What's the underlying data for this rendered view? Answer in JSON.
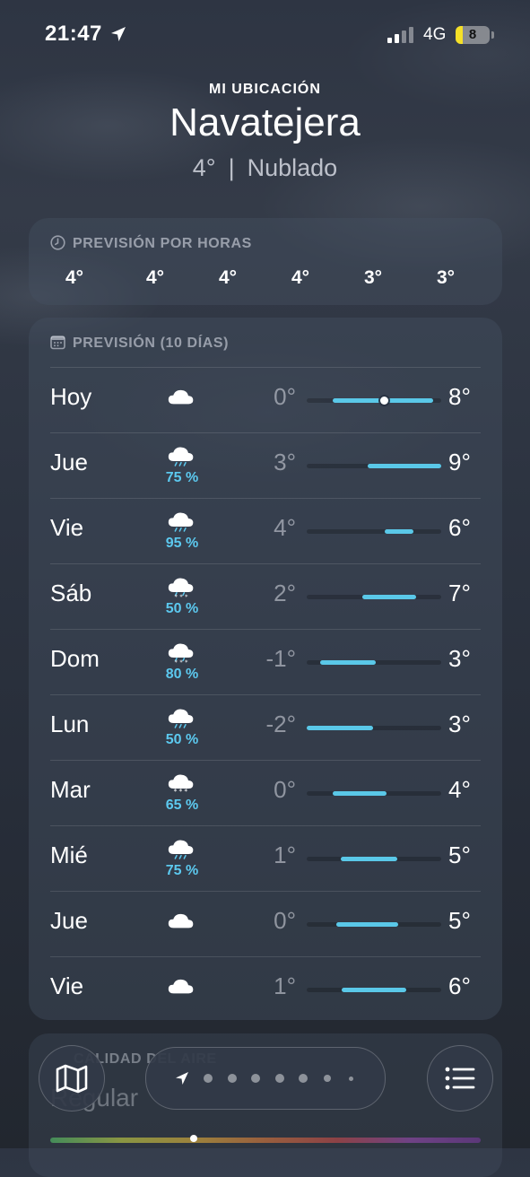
{
  "status_bar": {
    "time": "21:47",
    "network": "4G",
    "battery": "8"
  },
  "header": {
    "location_label": "MI UBICACIÓN",
    "city": "Navatejera",
    "temperature": "4°",
    "separator": "|",
    "condition": "Nublado"
  },
  "hourly": {
    "title": "PREVISIÓN POR HORAS",
    "temps": [
      "4°",
      "4°",
      "4°",
      "4°",
      "3°",
      "3°"
    ]
  },
  "daily": {
    "title": "PREVISIÓN (10 DÍAS)",
    "days": [
      {
        "day": "Hoy",
        "icon": "cloud-icon",
        "prob": "",
        "low": "0°",
        "high": "8°",
        "bar_start": 0.19,
        "bar_end": 0.94,
        "current": 0.57
      },
      {
        "day": "Jue",
        "icon": "cloud-rain-icon",
        "prob": "75 %",
        "low": "3°",
        "high": "9°",
        "bar_start": 0.45,
        "bar_end": 1.0
      },
      {
        "day": "Vie",
        "icon": "cloud-rain-icon",
        "prob": "95 %",
        "low": "4°",
        "high": "6°",
        "bar_start": 0.58,
        "bar_end": 0.79
      },
      {
        "day": "Sáb",
        "icon": "cloud-sleet-icon",
        "prob": "50 %",
        "low": "2°",
        "high": "7°",
        "bar_start": 0.41,
        "bar_end": 0.81
      },
      {
        "day": "Dom",
        "icon": "cloud-sleet-icon",
        "prob": "80 %",
        "low": "-1°",
        "high": "3°",
        "bar_start": 0.1,
        "bar_end": 0.51
      },
      {
        "day": "Lun",
        "icon": "cloud-rain-icon",
        "prob": "50 %",
        "low": "-2°",
        "high": "3°",
        "bar_start": 0.0,
        "bar_end": 0.49
      },
      {
        "day": "Mar",
        "icon": "cloud-snow-icon",
        "prob": "65 %",
        "low": "0°",
        "high": "4°",
        "bar_start": 0.19,
        "bar_end": 0.59
      },
      {
        "day": "Mié",
        "icon": "cloud-rain-icon",
        "prob": "75 %",
        "low": "1°",
        "high": "5°",
        "bar_start": 0.25,
        "bar_end": 0.67
      },
      {
        "day": "Jue",
        "icon": "cloud-icon",
        "prob": "",
        "low": "0°",
        "high": "5°",
        "bar_start": 0.22,
        "bar_end": 0.68
      },
      {
        "day": "Vie",
        "icon": "cloud-icon",
        "prob": "",
        "low": "1°",
        "high": "6°",
        "bar_start": 0.26,
        "bar_end": 0.74
      }
    ]
  },
  "air_quality": {
    "title": "CALIDAD DEL AIRE",
    "value": "Regular"
  },
  "nav": {
    "map": "map-icon",
    "list": "list-icon",
    "pages": 7
  },
  "colors": {
    "bar": "#5ac8e8",
    "probability": "#5cc9ef",
    "battery": "#f5e027"
  }
}
